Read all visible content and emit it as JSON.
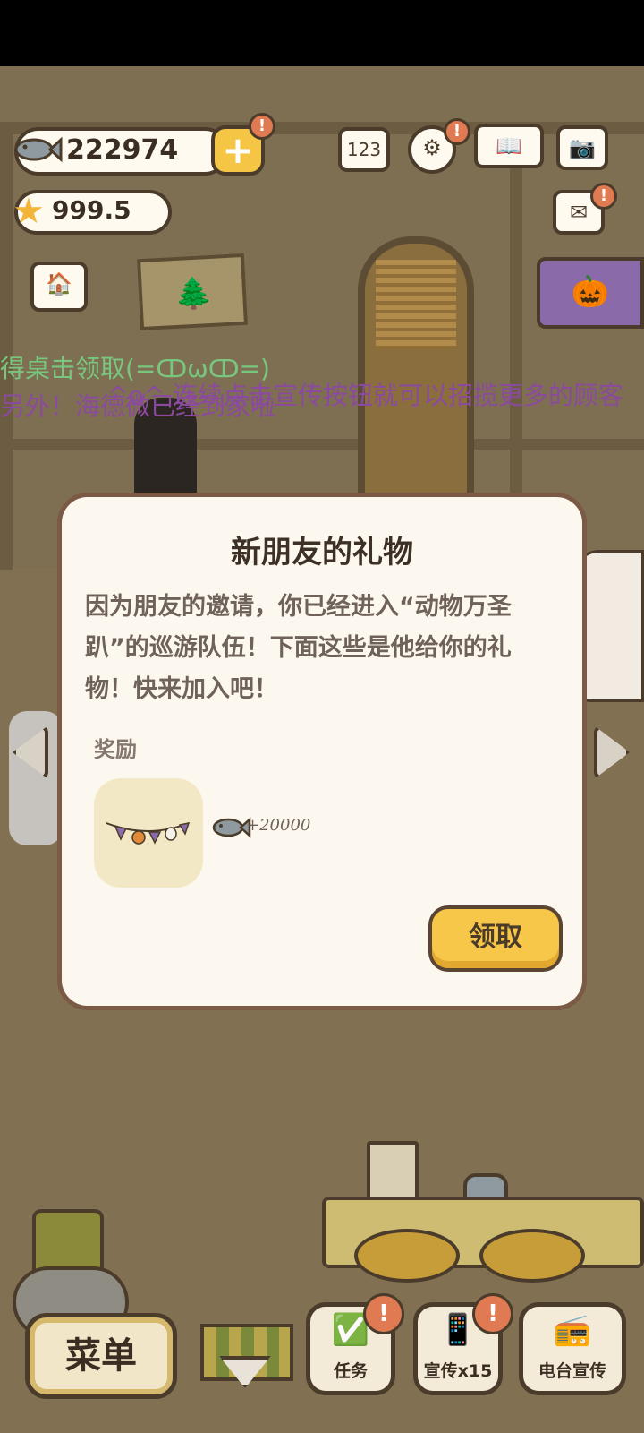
{
  "currency": {
    "fish": "222974",
    "stars": "999.5",
    "plus_label": "+",
    "alert_mark": "!"
  },
  "top_icons": {
    "ranking": "123",
    "settings": "⚙",
    "book": "📖",
    "camera": "📷",
    "mail": "✉",
    "shop": "🏠",
    "event": "🎃"
  },
  "tickers": {
    "line1": "得桌击领取(=ↀωↀ=)",
    "line2": "^o^ 连续点击宣传按钮就可以招揽更多的顾客",
    "line3": "另外！海德微已经到家啦"
  },
  "dialog": {
    "title": "新朋友的礼物",
    "body": "因为朋友的邀请，你已经进入“动物万圣趴”的巡游队伍！下面这些是他给你的礼物！快来加入吧！",
    "reward_label": "奖励",
    "reward_amount": "+20000",
    "claim_label": "领取"
  },
  "bottom_bar": {
    "menu_label": "菜单",
    "task_label": "任务",
    "promo_label": "宣传x15",
    "radio_label": "电台宣传",
    "task_icon": "✅",
    "promo_icon": "📱",
    "radio_icon": "📻"
  },
  "colors": {
    "accent": "#f7c74a",
    "panel": "#fdf8ef",
    "border": "#7a5a44",
    "alert": "#e07a52"
  }
}
